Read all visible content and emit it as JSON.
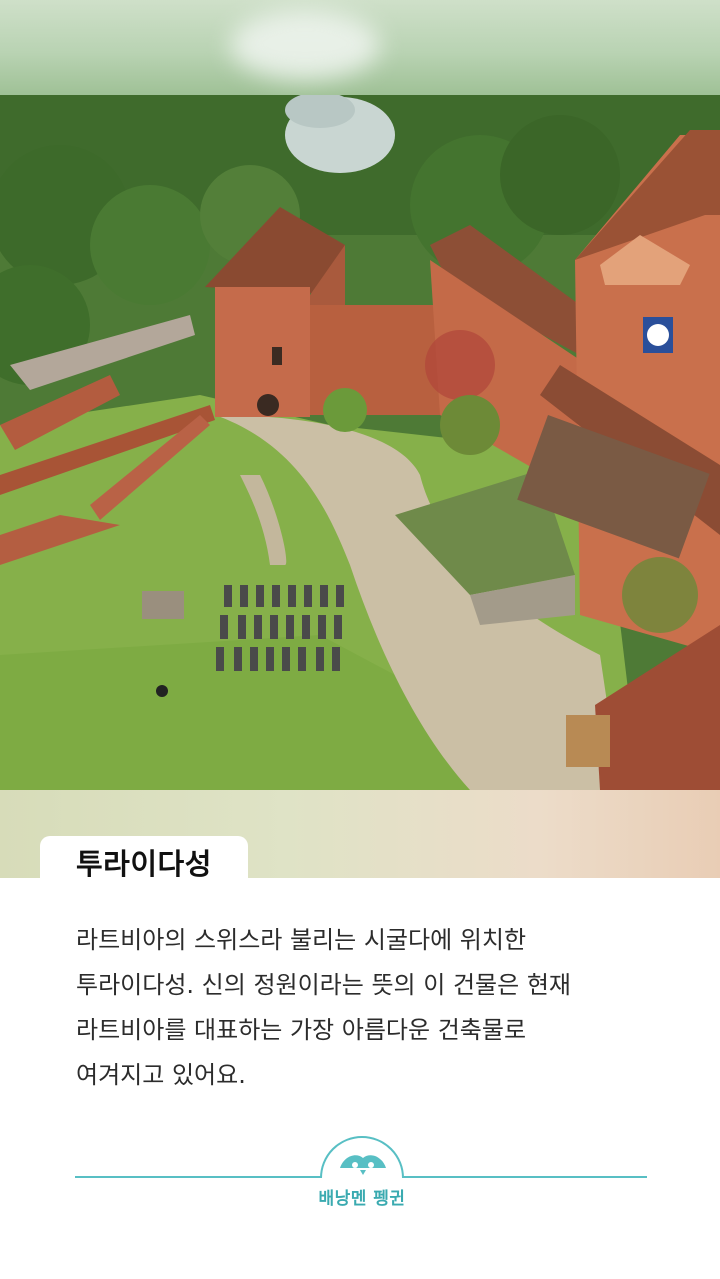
{
  "card": {
    "title": "투라이다성",
    "description_lines": [
      "라트비아의 스위스라 불리는 시굴다에 위치한",
      "투라이다성. 신의 정원이라는 뜻의 이 건물은 현재",
      "라트비아를 대표하는 가장 아름다운 건축물로",
      "여겨지고 있어요."
    ]
  },
  "brand": {
    "name": "배낭멘 펭귄",
    "accent_color": "#58bfc4"
  },
  "photo": {
    "icon": "castle-photo"
  }
}
